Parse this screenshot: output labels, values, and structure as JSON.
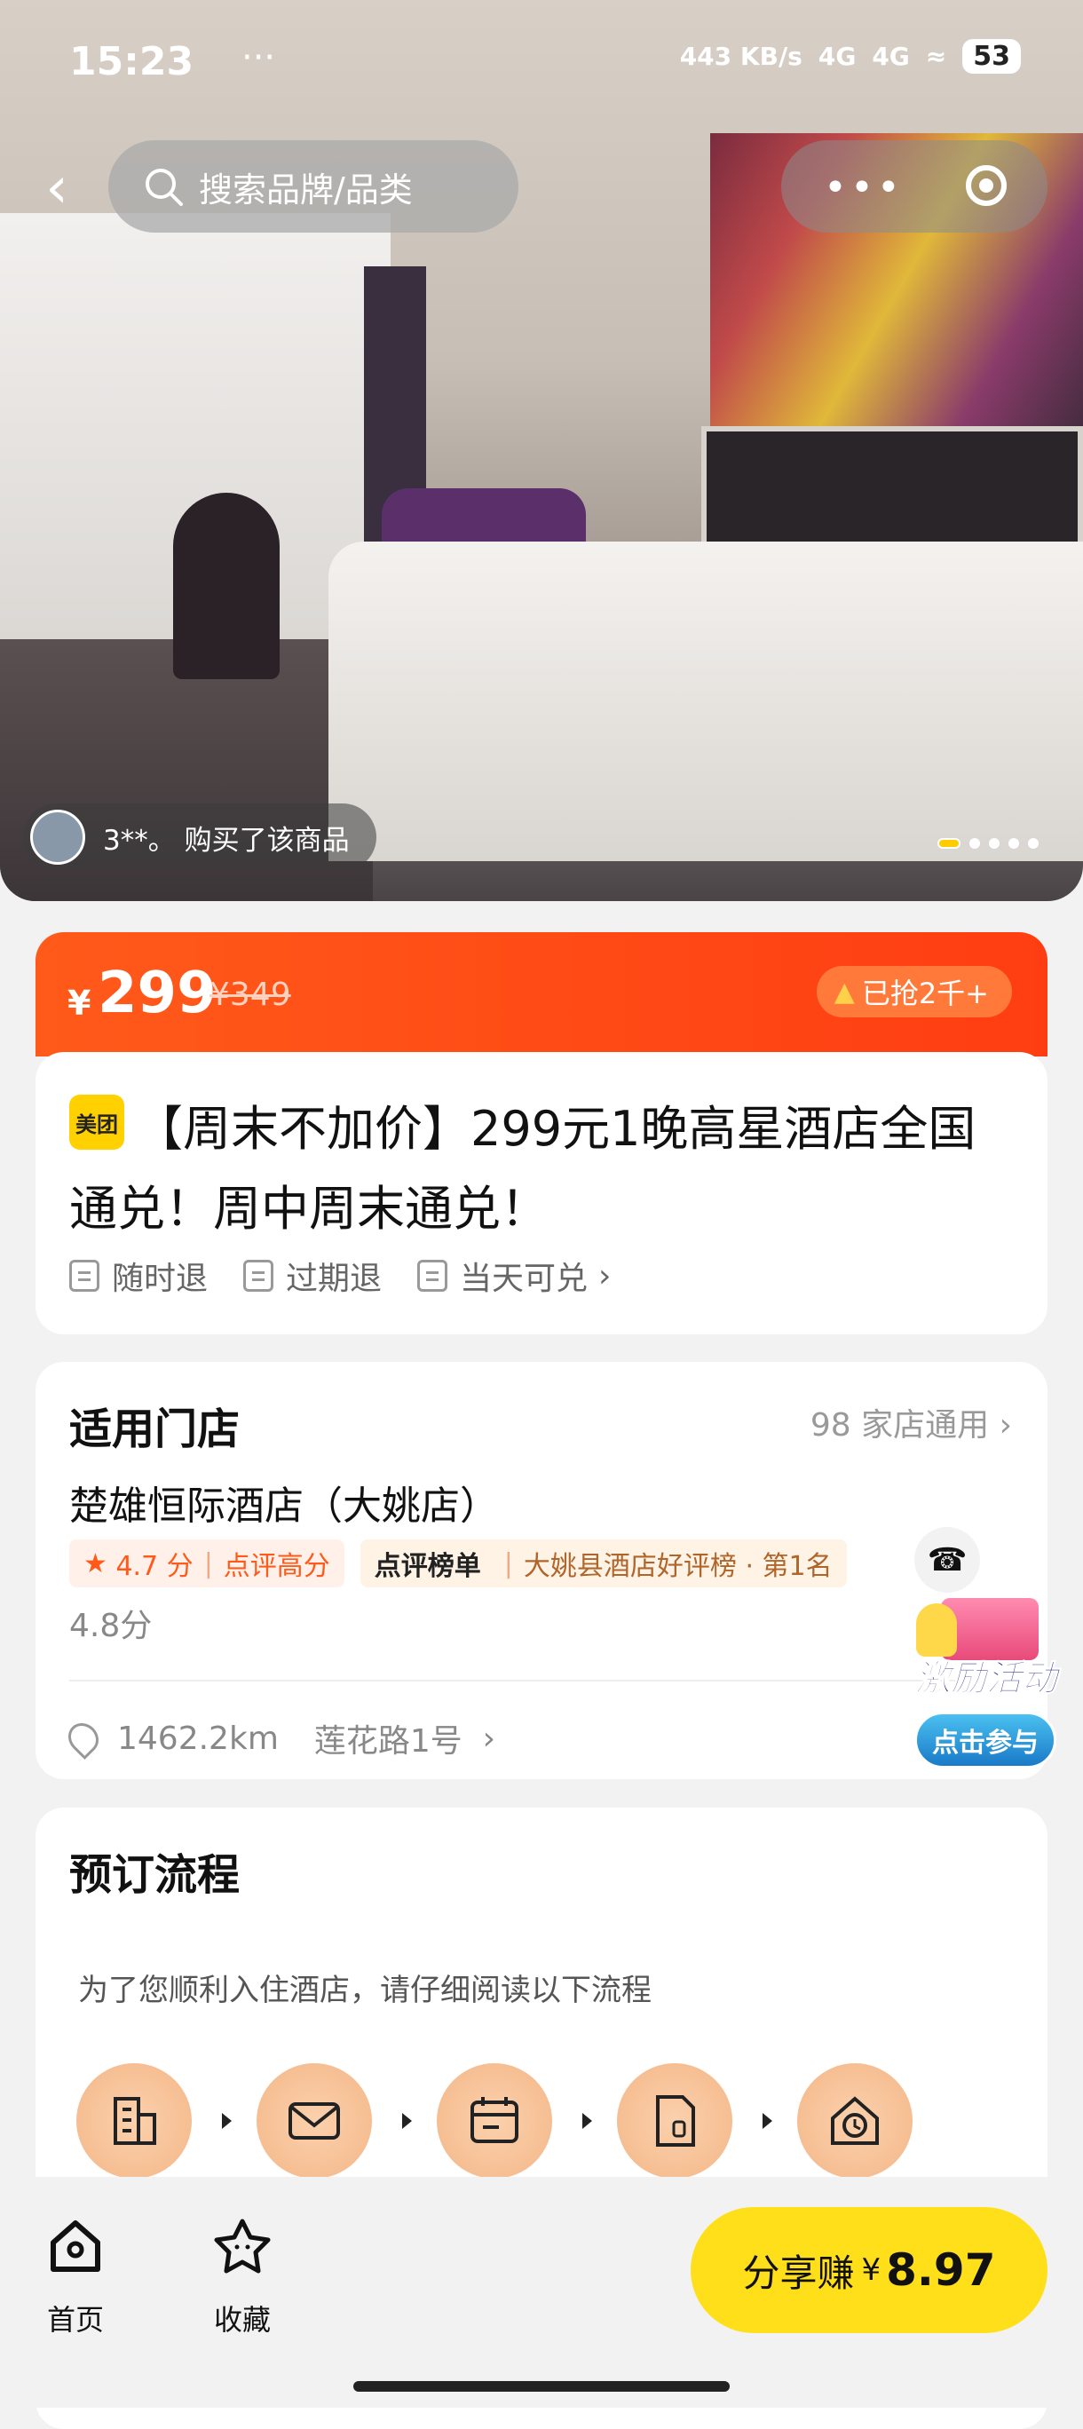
{
  "status_bar": {
    "time": "15:23",
    "extra": "···",
    "net_speed": "443 KB/s",
    "signal1": "4G",
    "signal2": "4G",
    "battery": "53"
  },
  "header": {
    "back_icon": "chevron-left-icon",
    "search_placeholder": "搜索品牌/品类",
    "more_icon": "more-dots-icon",
    "target_icon": "target-icon"
  },
  "hero": {
    "buyer_text": "3**。 购买了该商品",
    "pager_total": 5,
    "pager_active": 1
  },
  "price": {
    "currency": "¥",
    "value": "299",
    "original": "¥349",
    "sold": "已抢2千+"
  },
  "product": {
    "brand_badge": "美团",
    "title": "【周末不加价】299元1晚高星酒店全国通兑！周中周末通兑！",
    "tags": [
      "随时退",
      "过期退",
      "当天可兑"
    ]
  },
  "store": {
    "heading": "适用门店",
    "count_text": "98 家店通用",
    "name": "楚雄恒际酒店（大姚店）",
    "rating": "4.7 分",
    "rating_label": "点评高分",
    "rank_logo": "点评榜单",
    "rank_text": "大姚县酒店好评榜 · 第1名",
    "score": "4.8分",
    "distance": "1462.2km",
    "address": "莲花路1号"
  },
  "promo": {
    "title": "激励活动",
    "button": "点击参与"
  },
  "booking": {
    "heading": "预订流程",
    "note": "为了您顺利入住酒店，请仔细阅读以下流程",
    "steps": [
      "building-icon",
      "ticket-icon",
      "calendar-icon",
      "payment-icon",
      "home-clock-icon"
    ]
  },
  "bottom_nav": {
    "home_label": "首页",
    "fav_label": "收藏",
    "share_label": "分享赚",
    "share_currency": "¥",
    "share_amount": "8.97"
  },
  "colors": {
    "accent_orange": "#ff4a14",
    "share_yellow": "#ffdf1a",
    "step_peach": "#f4b687"
  }
}
